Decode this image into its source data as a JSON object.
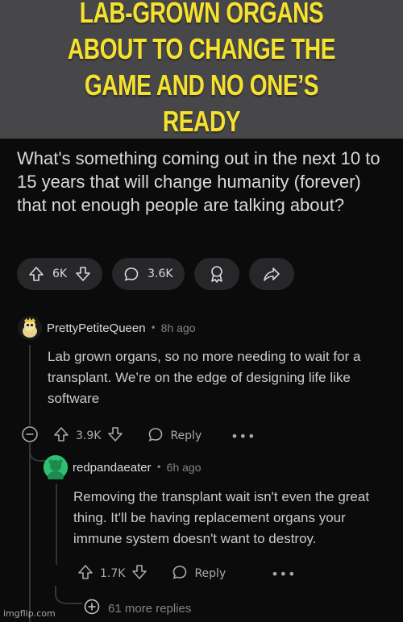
{
  "banner": {
    "caption": "LAB-GROWN ORGANS ABOUT TO CHANGE THE GAME AND NO ONE’S READY"
  },
  "post": {
    "title": "What's something coming out in the next 10 to 15 years that will change humanity (forever) that not enough people are talking about?",
    "upvotes": "6K",
    "comments": "3.6K"
  },
  "comment1": {
    "username": "PrettyPetiteQueen",
    "separator": "•",
    "age": "8h ago",
    "body": "Lab grown organs, so no more needing to wait for a transplant. We’re on the edge of designing life like software",
    "votes": "3.9K",
    "reply_label": "Reply",
    "more": "•••"
  },
  "comment2": {
    "username": "redpandaeater",
    "separator": "•",
    "age": "6h ago",
    "body": "Removing the transplant wait isn't even the great thing. It'll be having replacement organs your immune system doesn't want to destroy.",
    "votes": "1.7K",
    "reply_label": "Reply",
    "more": "•••"
  },
  "more_replies": {
    "label": "61 more replies"
  },
  "watermark": "imgflip.com",
  "colors": {
    "banner_bg": "#47474a",
    "banner_text": "#f6e22e",
    "page_bg": "#0b0b0c",
    "pill_bg": "#272729"
  }
}
